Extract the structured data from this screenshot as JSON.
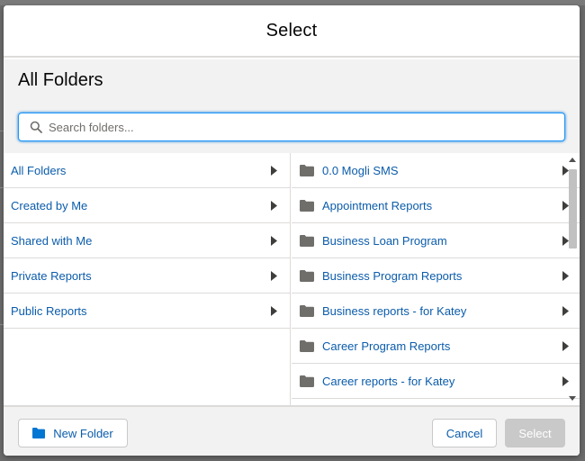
{
  "dialog": {
    "title": "Select",
    "section_title": "All Folders"
  },
  "search": {
    "placeholder": "Search folders...",
    "value": ""
  },
  "left_pane": {
    "items": [
      {
        "label": "All Folders"
      },
      {
        "label": "Created by Me"
      },
      {
        "label": "Shared with Me"
      },
      {
        "label": "Private Reports"
      },
      {
        "label": "Public Reports"
      }
    ]
  },
  "right_pane": {
    "items": [
      {
        "label": "0.0 Mogli SMS",
        "icon": "folder-icon"
      },
      {
        "label": "Appointment Reports",
        "icon": "folder-icon"
      },
      {
        "label": "Business Loan Program",
        "icon": "folder-icon"
      },
      {
        "label": "Business Program Reports",
        "icon": "folder-icon"
      },
      {
        "label": "Business reports - for Katey",
        "icon": "folder-icon"
      },
      {
        "label": "Career Program Reports",
        "icon": "folder-icon"
      },
      {
        "label": "Career reports - for Katey",
        "icon": "folder-icon"
      }
    ]
  },
  "footer": {
    "new_folder_label": "New Folder",
    "cancel_label": "Cancel",
    "select_label": "Select"
  },
  "colors": {
    "link": "#0b5cab",
    "folder_icon": "#706e6b",
    "new_folder_icon": "#0176d3",
    "disabled_button": "#c9c9c9",
    "search_focus": "#1b96ff"
  }
}
